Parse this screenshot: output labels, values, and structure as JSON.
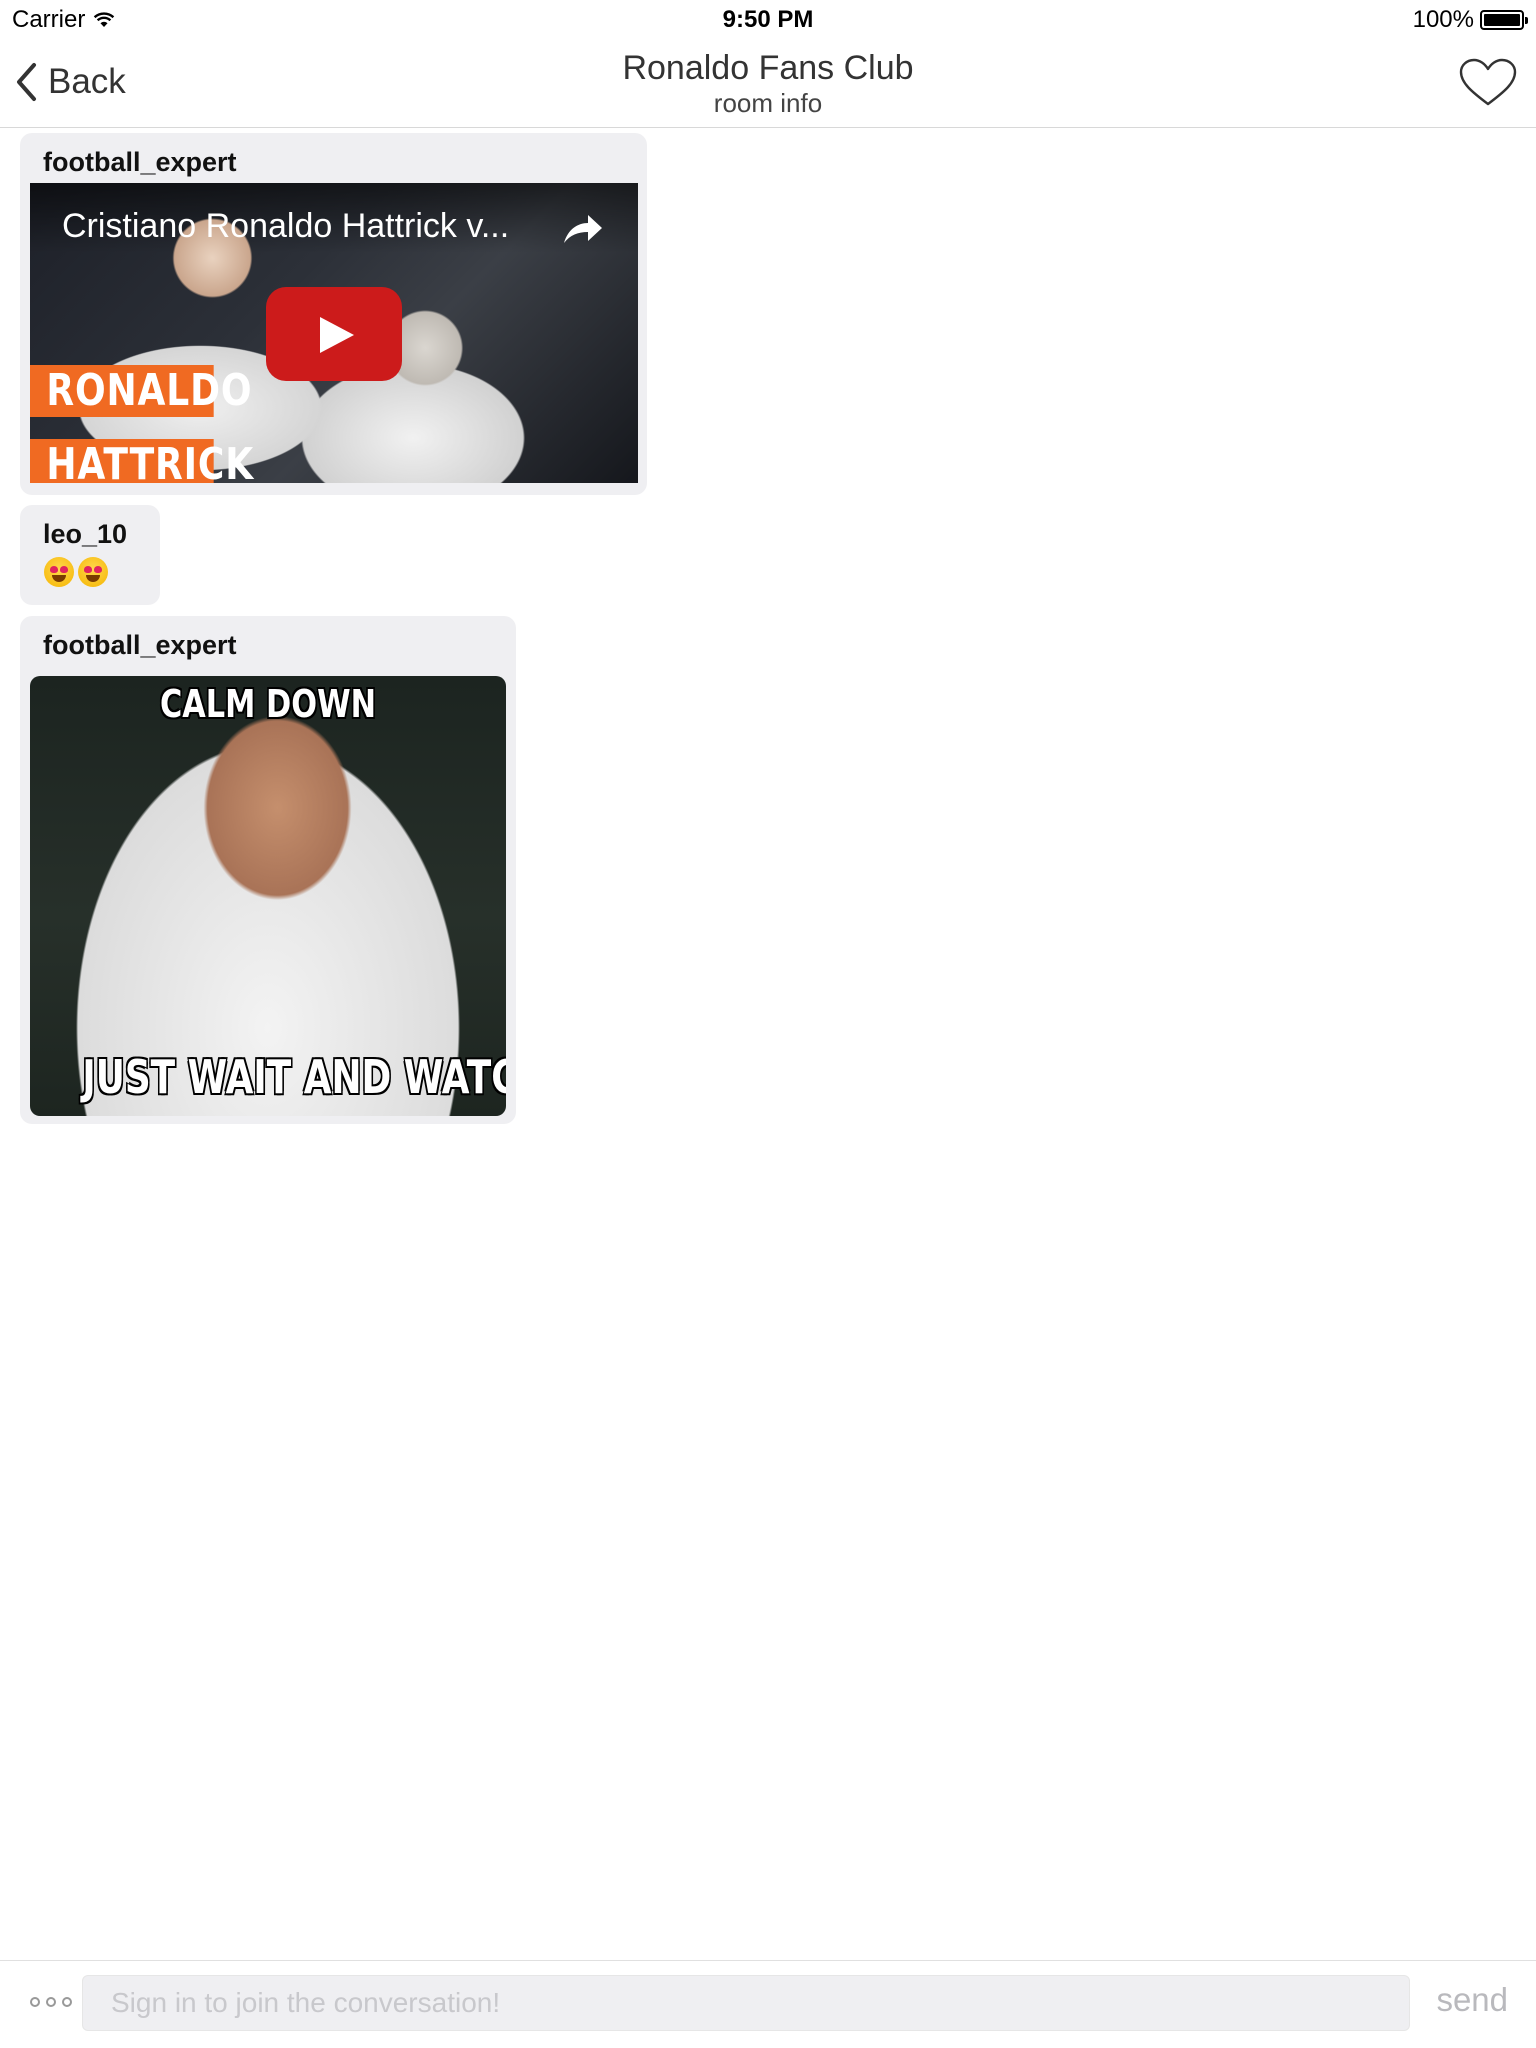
{
  "status_bar": {
    "carrier": "Carrier",
    "time": "9:50 PM",
    "battery": "100%"
  },
  "nav": {
    "back_label": "Back",
    "title": "Ronaldo Fans Club",
    "subtitle": "room info"
  },
  "messages": [
    {
      "username": "football_expert",
      "type": "video",
      "video_title": "Cristiano Ronaldo Hattrick v...",
      "thumbnail_labels": [
        "RONALDO",
        "HATTRICK"
      ]
    },
    {
      "username": "leo_10",
      "type": "emoji",
      "emoji": [
        "smiling-face-with-heart-eyes",
        "smiling-face-with-heart-eyes"
      ]
    },
    {
      "username": "football_expert",
      "type": "image",
      "meme_top": "CALM DOWN",
      "meme_bottom": "JUST WAIT AND WATCH"
    }
  ],
  "compose": {
    "placeholder": "Sign in to join the conversation!",
    "send_label": "send"
  },
  "colors": {
    "bubble_bg": "#efeff2",
    "play_button": "#cc1b1b",
    "orange_label": "#f06a22"
  }
}
